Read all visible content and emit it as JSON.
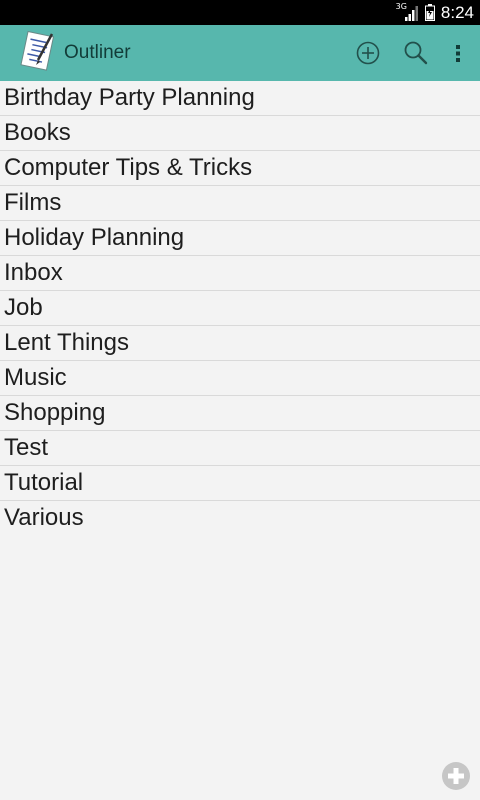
{
  "status_bar": {
    "network": "3G",
    "time": "8:24"
  },
  "app_bar": {
    "title": "Outliner",
    "icons": [
      "outliner-logo-icon",
      "add-circle-icon",
      "search-icon",
      "overflow-menu-icon"
    ]
  },
  "list": {
    "items": [
      {
        "label": "Birthday Party Planning"
      },
      {
        "label": "Books"
      },
      {
        "label": "Computer Tips & Tricks"
      },
      {
        "label": "Films"
      },
      {
        "label": "Holiday Planning"
      },
      {
        "label": "Inbox"
      },
      {
        "label": "Job"
      },
      {
        "label": "Lent Things"
      },
      {
        "label": "Music"
      },
      {
        "label": "Shopping"
      },
      {
        "label": "Test"
      },
      {
        "label": "Tutorial"
      },
      {
        "label": "Various"
      }
    ]
  },
  "fab": {
    "icon": "plus-icon"
  },
  "colors": {
    "app_bar": "#57b7ad",
    "background": "#f3f3f3",
    "divider": "#d9d9d9",
    "text": "#1e1e1e",
    "status_bar": "#000000"
  }
}
